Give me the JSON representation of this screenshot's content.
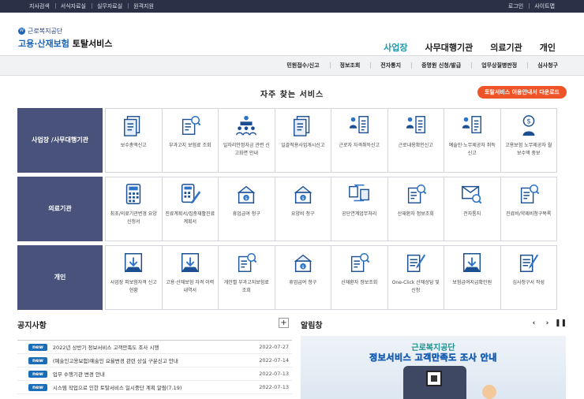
{
  "topbar": {
    "left": [
      "지사검색",
      "서식자료실",
      "실무자료실",
      "원격지원"
    ],
    "right": [
      "로그인",
      "사이트맵"
    ]
  },
  "logo": {
    "mark": "W",
    "org": "근로복지공단",
    "svc_a": "고용·산재보험",
    "svc_b": "토탈서비스"
  },
  "mainnav": [
    "사업장",
    "사무대행기관",
    "의료기관",
    "개인"
  ],
  "subnav": [
    "민원접수/신고",
    "정보조회",
    "전자통지",
    "증명원 신청/발급",
    "업무상질병판정",
    "심사청구"
  ],
  "section": {
    "title": "자주 찾는 서비스",
    "download": "토탈서비스 이용안내서 다운로드"
  },
  "rows": [
    {
      "label_a": "사업장 /",
      "label_b": "사무대행기관",
      "items": [
        {
          "icon": "document-list-icon",
          "label": "보수총액신고"
        },
        {
          "icon": "document-search-icon",
          "label": "부과고지 보험료 조회"
        },
        {
          "icon": "meeting-people-icon",
          "label": "일자리안정자금 관련 신고화면 안내"
        },
        {
          "icon": "document-list-icon",
          "label": "일괄적용사업개시신고"
        },
        {
          "icon": "people-list-icon",
          "label": "근로자 자격취득신고"
        },
        {
          "icon": "people-list-icon",
          "label": "근로내용확인신고"
        },
        {
          "icon": "people-list-icon",
          "label": "예술인·노무제공자 취득신고"
        },
        {
          "icon": "coin-person-icon",
          "label": "고용보험 노무제공자 월보수액 중보"
        }
      ]
    },
    {
      "label_a": "의료기관",
      "label_b": "",
      "items": [
        {
          "icon": "calculator-icon",
          "label": "최초/의료기관변경 요양신청서"
        },
        {
          "icon": "calculator-pen-icon",
          "label": "진료계획서/집중재활진료계획서"
        },
        {
          "icon": "money-box-icon",
          "label": "휴업급여 청구"
        },
        {
          "icon": "money-box-icon",
          "label": "요양비 청구"
        },
        {
          "icon": "transfer-icon",
          "label": "공단연계업무처리"
        },
        {
          "icon": "document-search-icon",
          "label": "산재환자 정보조회"
        },
        {
          "icon": "notice-search-icon",
          "label": "전자통지"
        },
        {
          "icon": "document-search-icon",
          "label": "진료비/약제비청구목록"
        }
      ]
    },
    {
      "label_a": "개인",
      "label_b": "",
      "items": [
        {
          "icon": "folder-download-icon",
          "label": "사업장 피보험자격 신고현황"
        },
        {
          "icon": "folder-download-icon",
          "label": "고용·산재보험 자격 이력 내역서"
        },
        {
          "icon": "document-search-icon",
          "label": "개인별 부과고지보험료 조회"
        },
        {
          "icon": "money-box-icon",
          "label": "휴업급여 청구"
        },
        {
          "icon": "document-search-icon",
          "label": "산재환자 정보조회"
        },
        {
          "icon": "pen-document-icon",
          "label": "One-Click 산재상담 및 신청"
        },
        {
          "icon": "folder-download-icon",
          "label": "보험급여지급확인원"
        },
        {
          "icon": "pen-document-icon",
          "label": "심사청구서 작성"
        }
      ]
    }
  ],
  "notice": {
    "title": "공지사항",
    "plus": "+",
    "badge": "new",
    "items": [
      {
        "text": "2022년 상반기 정보서비스 고객만족도 조사 시행",
        "date": "2022-07-27"
      },
      {
        "text": "(예술인고용보험)예술인 요율변경 관련 상실 구분신고 안내",
        "date": "2022-07-14"
      },
      {
        "text": "업무 수행기관 변경 안내",
        "date": "2022-07-13"
      },
      {
        "text": "시스템 작업으로 인한 토탈서비스 일시중단 계획 알림(7.19)",
        "date": "2022-07-13"
      }
    ]
  },
  "alarm": {
    "title": "알림창",
    "prev": "‹",
    "next": "›",
    "pause": "❚❚",
    "banner_org": "근로복지공단",
    "banner_title": "정보서비스 고객만족도 조사 안내"
  },
  "colors": {
    "topbar": "#2a3045",
    "row_label": "#48527a",
    "accent": "#1a9aa8",
    "download": "#ee5427",
    "new_badge": "#1a6db7"
  }
}
